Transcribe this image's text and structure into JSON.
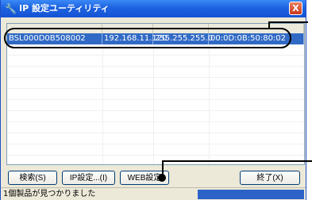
{
  "window": {
    "title": "IP 設定ユーティリティ",
    "close_label": "X"
  },
  "list": {
    "rows": [
      {
        "name": "BSL000D0B508002",
        "ip": "192.168.11.120",
        "subnet": "255.255.255.0",
        "mac": "00:0D:0B:50:80:02",
        "selected": true
      }
    ]
  },
  "buttons": {
    "search": "検索(S)",
    "ip_settings": "IP設定...(I)",
    "web_settings": "WEB設定",
    "exit": "終了(X)"
  },
  "status": {
    "message": "1個製品が見つかりました"
  },
  "colors": {
    "titlebar": "#1d62e0",
    "selection": "#316ac5",
    "close_button": "#c9381c",
    "progress": "#2d62c8"
  },
  "icons": {
    "title_icon": "wrench-icon",
    "close_icon": "close-icon"
  }
}
